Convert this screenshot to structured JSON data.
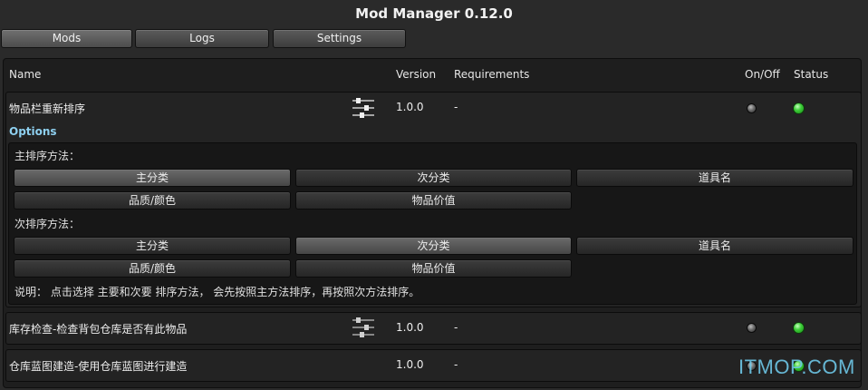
{
  "app": {
    "title": "Mod Manager 0.12.0"
  },
  "tabs": [
    {
      "label": "Mods",
      "active": true
    },
    {
      "label": "Logs",
      "active": false
    },
    {
      "label": "Settings",
      "active": false
    }
  ],
  "columns": {
    "name": "Name",
    "version": "Version",
    "requirements": "Requirements",
    "onoff": "On/Off",
    "status": "Status"
  },
  "mods": [
    {
      "name": "物品栏重新排序",
      "version": "1.0.0",
      "requirements": "-",
      "enabled": false,
      "status": "green",
      "has_settings_icon": true
    },
    {
      "name": "库存检查-检查背包仓库是否有此物品",
      "version": "1.0.0",
      "requirements": "-",
      "enabled": false,
      "status": "green",
      "has_settings_icon": true
    },
    {
      "name": "仓库蓝图建造-使用仓库蓝图进行建造",
      "version": "1.0.0",
      "requirements": "-",
      "enabled": false,
      "status": "green",
      "has_settings_icon": false
    }
  ],
  "options": {
    "title": "Options",
    "primary_label": "主排序方法：",
    "primary_buttons": [
      {
        "label": "主分类",
        "selected": true
      },
      {
        "label": "次分类",
        "selected": false
      },
      {
        "label": "道具名",
        "selected": false
      },
      {
        "label": "品质/颜色",
        "selected": false
      },
      {
        "label": "物品价值",
        "selected": false
      }
    ],
    "secondary_label": "次排序方法：",
    "secondary_buttons": [
      {
        "label": "主分类",
        "selected": false
      },
      {
        "label": "次分类",
        "selected": true
      },
      {
        "label": "道具名",
        "selected": false
      },
      {
        "label": "品质/颜色",
        "selected": false
      },
      {
        "label": "物品价值",
        "selected": false
      }
    ],
    "note": "说明： 点击选择 主要和次要 排序方法， 会先按照主方法排序，再按照次方法排序。"
  },
  "watermark": "ITMOP.COM",
  "colors": {
    "status_green": "#3fcf3a",
    "options_title": "#8ed0f0",
    "watermark": "#6ec8e8"
  }
}
